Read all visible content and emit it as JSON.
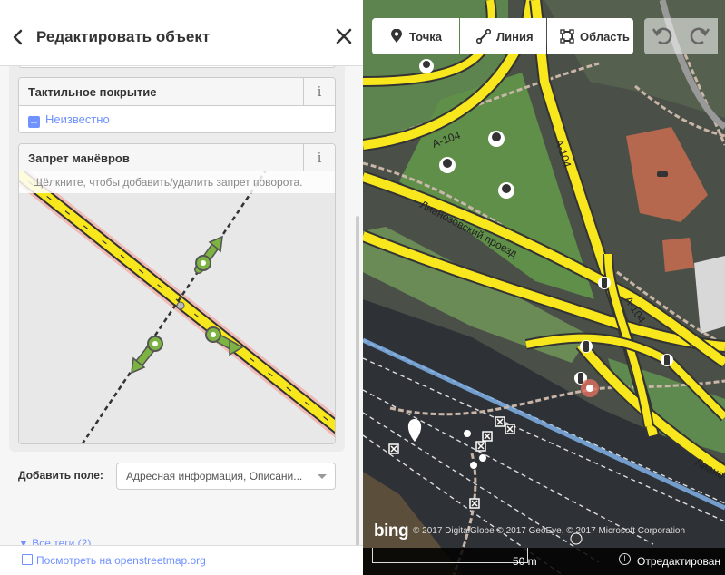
{
  "sidebar": {
    "title": "Редактировать объект",
    "back_icon": "chevron-left-icon",
    "close_icon": "close-icon",
    "tactile": {
      "label": "Тактильное покрытие",
      "info": "i",
      "value": "Неизвестно"
    },
    "turn_restrictions": {
      "label": "Запрет манёвров",
      "info": "i",
      "hint": "Щёлкните, чтобы добавить/удалить запрет поворота."
    },
    "add_field": {
      "label": "Добавить поле:",
      "value": "Адресная информация, Описани..."
    },
    "all_tags": "▼ Все теги (2)",
    "osm_link": "Посмотреть на openstreetmap.org"
  },
  "map": {
    "toolbar": {
      "point": "Точка",
      "line": "Линия",
      "area": "Область"
    },
    "road_labels": {
      "a104_left": "А-104",
      "a104_top": "А-104",
      "a104_mid": "А-104",
      "lianozovsky": "Лианозовский проезд",
      "lianozovsky_cut": "Лиано"
    },
    "bing": "bing",
    "attribution": "© 2017 DigitalGlobe © 2017 GeoEye, © 2017 Microsoft Corporation",
    "scale": "50 m",
    "edited": "Отредактирован"
  },
  "colors": {
    "accent": "#7092ff",
    "road_yellow": "#f8e71c",
    "selected_vertex": "#e06e5f",
    "turn_allowed": "#7cb342"
  }
}
